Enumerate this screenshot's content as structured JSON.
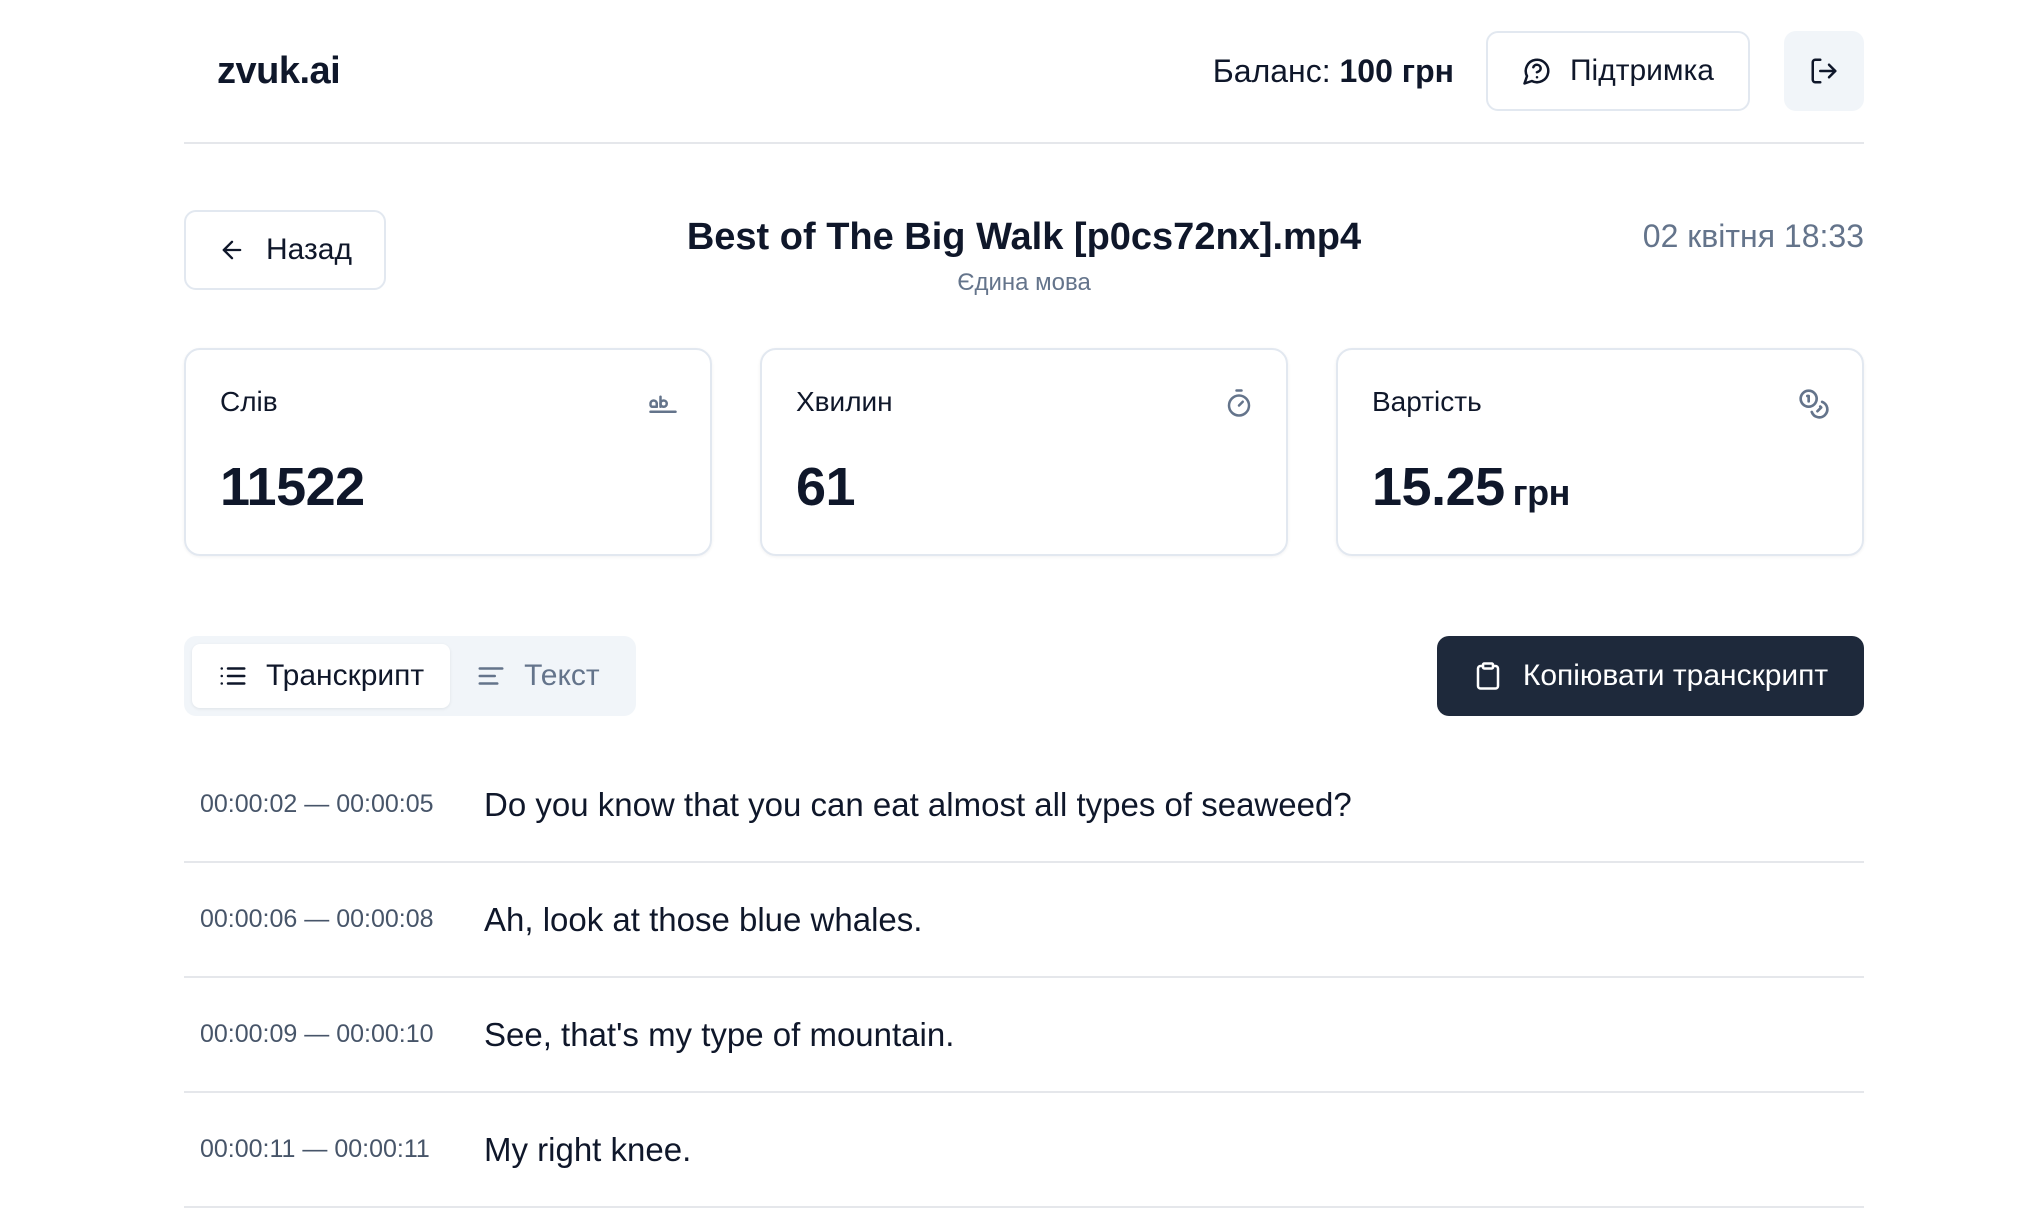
{
  "header": {
    "logo": "zvuk.ai",
    "balance_label": "Баланс:",
    "balance_amount": "100 грн",
    "support_label": "Підтримка"
  },
  "file": {
    "back_label": "Назад",
    "title": "Best of The Big Walk [p0cs72nx].mp4",
    "mode": "Єдина мова",
    "date": "02 квітня 18:33"
  },
  "stats": [
    {
      "label": "Слів",
      "value": "11522",
      "unit": "",
      "icon": "spell-check-icon"
    },
    {
      "label": "Хвилин",
      "value": "61",
      "unit": "",
      "icon": "timer-icon"
    },
    {
      "label": "Вартість",
      "value": "15.25",
      "unit": "грн",
      "icon": "coins-icon"
    }
  ],
  "tabs": {
    "transcript_label": "Транскрипт",
    "text_label": "Текст",
    "active": "transcript"
  },
  "copy_button_label": "Копіювати транскрипт",
  "transcript": [
    {
      "time": "00:00:02 — 00:00:05",
      "text": "Do you know that you can eat almost all types of seaweed?"
    },
    {
      "time": "00:00:06 — 00:00:08",
      "text": "Ah, look at those blue whales."
    },
    {
      "time": "00:00:09 — 00:00:10",
      "text": "See, that's my type of mountain."
    },
    {
      "time": "00:00:11 — 00:00:11",
      "text": "My right knee."
    }
  ]
}
